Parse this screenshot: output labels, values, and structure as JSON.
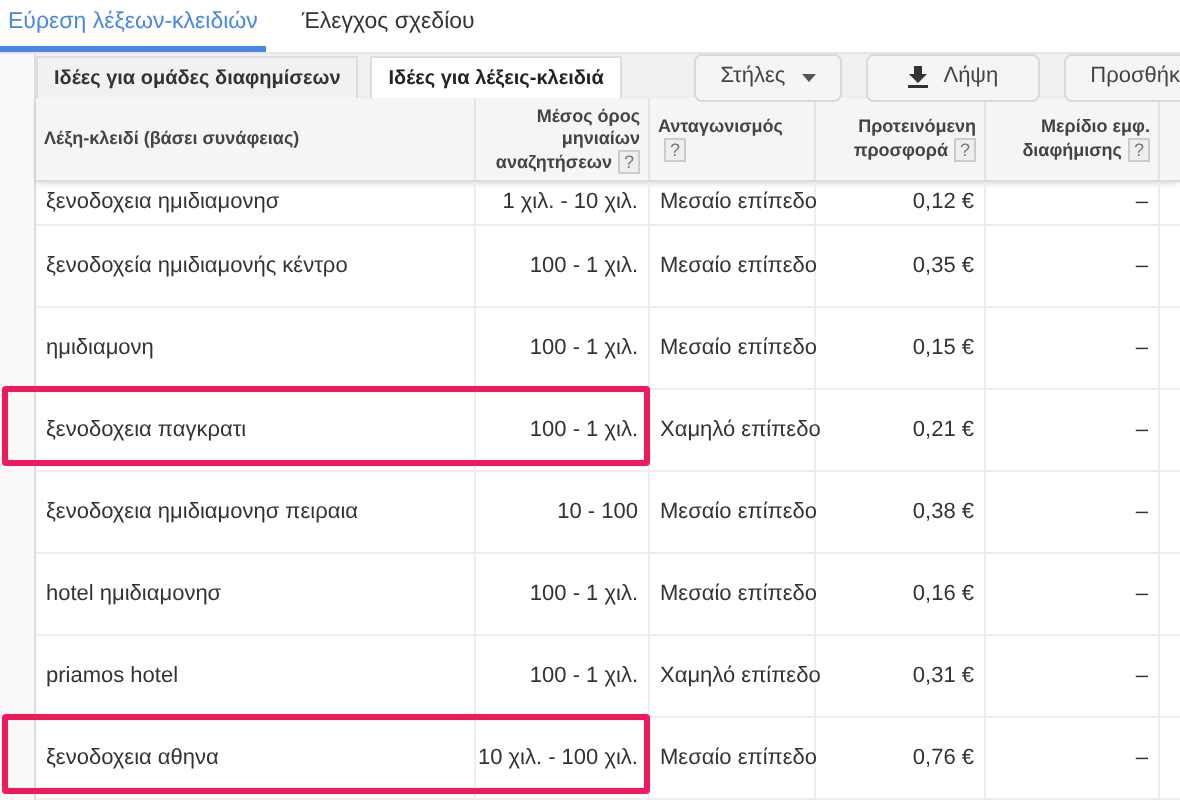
{
  "main_tabs": [
    {
      "label": "Εύρεση λέξεων-κλειδιών",
      "selected": true
    },
    {
      "label": "Έλεγχος σχεδίου",
      "selected": false
    }
  ],
  "sub_tabs": [
    {
      "label": "Ιδέες για ομάδες διαφημίσεων",
      "selected": false
    },
    {
      "label": "Ιδέες για λέξεις-κλειδιά",
      "selected": true
    }
  ],
  "toolbar": [
    {
      "kind": "dropdown",
      "label": "Στήλες"
    },
    {
      "kind": "download",
      "label": "Λήψη"
    },
    {
      "kind": "plain",
      "label": "Προσθήκ"
    }
  ],
  "table": {
    "columns": [
      {
        "label": "Λέξη-κλειδί (βάσει συνάφειας)"
      },
      {
        "label": "Μέσος όρος μηνιαίων αναζητήσεων",
        "help": "?"
      },
      {
        "label": "Ανταγωνισμός",
        "help": "?"
      },
      {
        "label": "Προτεινόμενη προσφορά",
        "help": "?"
      },
      {
        "label": "Μερίδιο εμφ. διαφήμισης",
        "help": "?"
      }
    ],
    "rows": [
      {
        "cells": [
          "ξενοδοχεια ημιδιαμονησ",
          "1 χιλ. - 10 χιλ.",
          "Μεσαίο επίπεδο",
          "0,12 €",
          "–"
        ],
        "highlighted": false
      },
      {
        "cells": [
          "ξενοδοχεία ημιδιαμονής κέντρο",
          "100 - 1 χιλ.",
          "Μεσαίο επίπεδο",
          "0,35 €",
          "–"
        ],
        "highlighted": false
      },
      {
        "cells": [
          "ημιδιαμονη",
          "100 - 1 χιλ.",
          "Μεσαίο επίπεδο",
          "0,15 €",
          "–"
        ],
        "highlighted": false
      },
      {
        "cells": [
          "ξενοδοχεια παγκρατι",
          "100 - 1 χιλ.",
          "Χαμηλό επίπεδο",
          "0,21 €",
          "–"
        ],
        "highlighted": true
      },
      {
        "cells": [
          "ξενοδοχεια ημιδιαμονησ πειραια",
          "10 - 100",
          "Μεσαίο επίπεδο",
          "0,38 €",
          "–"
        ],
        "highlighted": false
      },
      {
        "cells": [
          "hotel ημιδιαμονησ",
          "100 - 1 χιλ.",
          "Μεσαίο επίπεδο",
          "0,16 €",
          "–"
        ],
        "highlighted": false
      },
      {
        "cells": [
          "priamos hotel",
          "100 - 1 χιλ.",
          "Χαμηλό επίπεδο",
          "0,31 €",
          "–"
        ],
        "highlighted": false
      },
      {
        "cells": [
          "ξενοδοχεια αθηνα",
          "10 χιλ. - 100 χιλ.",
          "Μεσαίο επίπεδο",
          "0,76 €",
          "–"
        ],
        "highlighted": true
      }
    ]
  }
}
